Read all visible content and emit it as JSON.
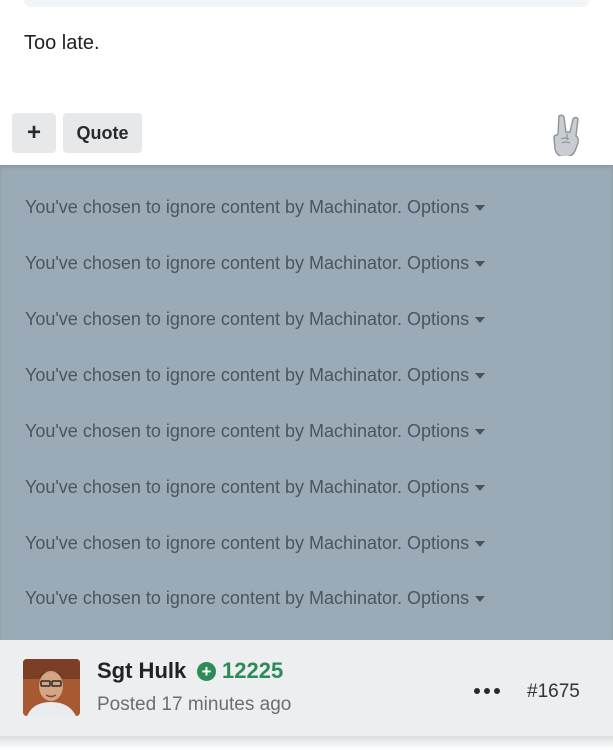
{
  "previous_post": {
    "text": "Too late.",
    "buttons": {
      "plus_label": "+",
      "quote_label": "Quote"
    },
    "reaction_icon": "rock-on-hand-icon"
  },
  "ignored_notices": [
    {
      "text": "You've chosen to ignore content by Machinator.",
      "options_label": "Options"
    },
    {
      "text": "You've chosen to ignore content by Machinator.",
      "options_label": "Options"
    },
    {
      "text": "You've chosen to ignore content by Machinator.",
      "options_label": "Options"
    },
    {
      "text": "You've chosen to ignore content by Machinator.",
      "options_label": "Options"
    },
    {
      "text": "You've chosen to ignore content by Machinator.",
      "options_label": "Options"
    },
    {
      "text": "You've chosen to ignore content by Machinator.",
      "options_label": "Options"
    },
    {
      "text": "You've chosen to ignore content by Machinator.",
      "options_label": "Options"
    },
    {
      "text": "You've chosen to ignore content by Machinator.",
      "options_label": "Options"
    }
  ],
  "next_post": {
    "username": "Sgt Hulk",
    "reputation": "12225",
    "posted": "Posted 17 minutes ago",
    "post_number": "#1675"
  },
  "colors": {
    "ignored_background": "#9aabb7",
    "reputation_green": "#2e8b57",
    "header_background": "#eceeef"
  }
}
